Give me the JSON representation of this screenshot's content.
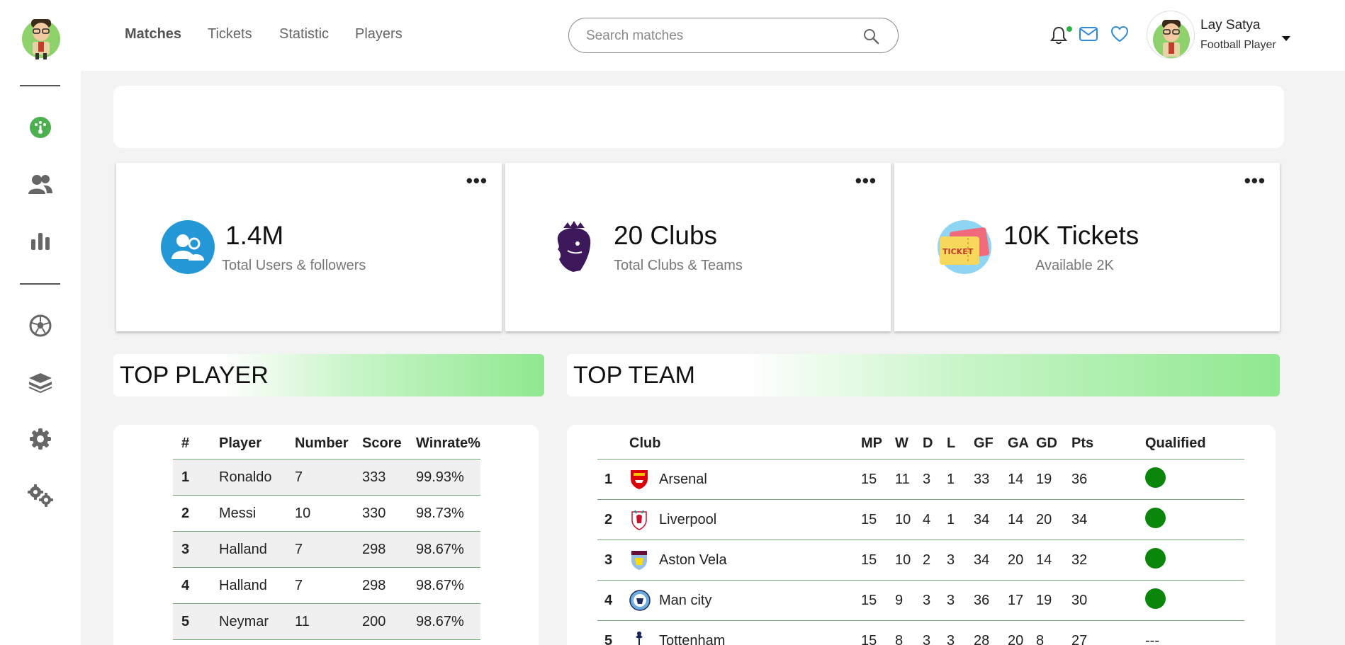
{
  "nav": {
    "items": [
      "Matches",
      "Tickets",
      "Statistic",
      "Players"
    ],
    "active": "Matches"
  },
  "search": {
    "placeholder": "Search matches",
    "value": ""
  },
  "profile": {
    "name": "Lay Satya",
    "role": "Football Player"
  },
  "stats": [
    {
      "value": "1.4M",
      "label": "Total Users & followers",
      "icon": "users-icon"
    },
    {
      "value": "20 Clubs",
      "label": "Total Clubs & Teams",
      "icon": "premier-league-lion-icon"
    },
    {
      "value": "10K Tickets",
      "label": "Available 2K",
      "icon": "ticket-icon"
    }
  ],
  "sections": {
    "top_player": "TOP PLAYER",
    "top_team": "TOP TEAM"
  },
  "player_table": {
    "headers": [
      "#",
      "Player",
      "Number",
      "Score",
      "Winrate%"
    ],
    "rows": [
      [
        "1",
        "Ronaldo",
        "7",
        "333",
        "99.93%"
      ],
      [
        "2",
        "Messi",
        "10",
        "330",
        "98.73%"
      ],
      [
        "3",
        "Halland",
        "7",
        "298",
        "98.67%"
      ],
      [
        "4",
        "Halland",
        "7",
        "298",
        "98.67%"
      ],
      [
        "5",
        "Neymar",
        "11",
        "200",
        "98.67%"
      ]
    ]
  },
  "team_table": {
    "headers": [
      "Club",
      "MP",
      "W",
      "D",
      "L",
      "GF",
      "GA",
      "GD",
      "Pts",
      "Qualified"
    ],
    "rows": [
      {
        "rank": "1",
        "club": "Arsenal",
        "mp": "15",
        "w": "11",
        "d": "3",
        "l": "1",
        "gf": "33",
        "ga": "14",
        "gd": "19",
        "pts": "36",
        "qualified": true
      },
      {
        "rank": "2",
        "club": "Liverpool",
        "mp": "15",
        "w": "10",
        "d": "4",
        "l": "1",
        "gf": "34",
        "ga": "14",
        "gd": "20",
        "pts": "34",
        "qualified": true
      },
      {
        "rank": "3",
        "club": "Aston Vela",
        "mp": "15",
        "w": "10",
        "d": "2",
        "l": "3",
        "gf": "34",
        "ga": "20",
        "gd": "14",
        "pts": "32",
        "qualified": true
      },
      {
        "rank": "4",
        "club": "Man city",
        "mp": "15",
        "w": "9",
        "d": "3",
        "l": "3",
        "gf": "36",
        "ga": "17",
        "gd": "19",
        "pts": "30",
        "qualified": true
      },
      {
        "rank": "5",
        "club": "Tottenham",
        "mp": "15",
        "w": "8",
        "d": "3",
        "l": "3",
        "gf": "28",
        "ga": "20",
        "gd": "8",
        "pts": "27",
        "qualified": false,
        "qualified_text": "---"
      }
    ]
  },
  "colors": {
    "accent_green": "#8fe88f",
    "qualified": "#0a870a",
    "dashboard_icon": "#4caf50",
    "mail_icon": "#2e8bd8"
  }
}
